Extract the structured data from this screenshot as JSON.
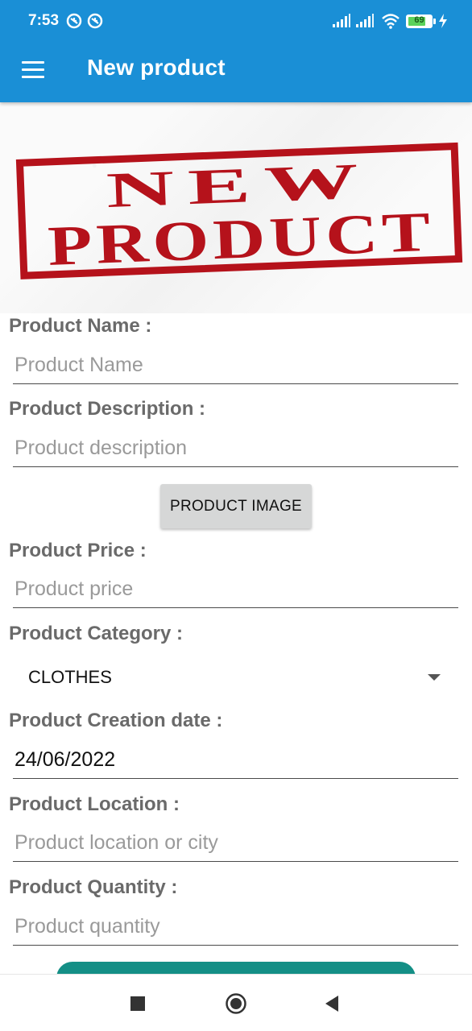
{
  "status_bar": {
    "time": "7:53",
    "battery": "69"
  },
  "toolbar": {
    "title": "New product",
    "menu_icon": "hamburger-menu-icon"
  },
  "banner": {
    "line1": "NEW",
    "line2": "PRODUCT",
    "stamp_color": "#b5121b"
  },
  "form": {
    "name_label": "Product Name :",
    "name_placeholder": "Product Name",
    "description_label": "Product Description :",
    "description_placeholder": "Product description",
    "image_button": "PRODUCT IMAGE",
    "price_label": "Product Price :",
    "price_placeholder": "Product price",
    "category_label": "Product Category :",
    "category_value": "CLOTHES",
    "date_label": "Product Creation date :",
    "date_value": "24/06/2022",
    "location_label": "Product Location :",
    "location_placeholder": "Product location or city",
    "quantity_label": "Product Quantity :",
    "quantity_placeholder": "Product quantity"
  },
  "colors": {
    "appbar": "#1a8fd6",
    "submit": "#148f86"
  },
  "navigation": {
    "recents_icon": "square-icon",
    "home_icon": "circle-home-icon",
    "back_icon": "triangle-back-icon"
  }
}
